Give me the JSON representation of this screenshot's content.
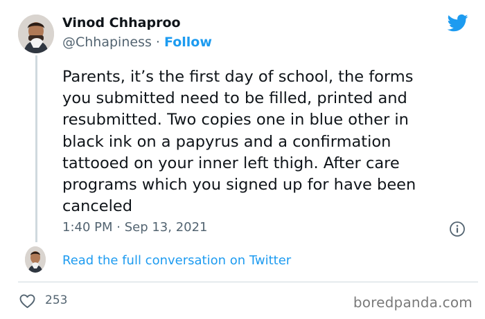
{
  "tweet": {
    "display_name": "Vinod Chhaproo",
    "handle": "@Chhapiness",
    "separator": " · ",
    "follow_label": "Follow",
    "text": "Parents, it’s the first day of school, the forms\nyou submitted need to be filled, printed and\nresubmitted. Two copies one in blue other in\nblack ink on a papyrus and a confirmation\ntattooed on your inner left thigh. After care\nprograms which you signed up for have been\ncanceled",
    "timestamp": "1:40 PM · Sep 13, 2021",
    "read_link": "Read the full conversation on Twitter",
    "like_count": "253"
  },
  "watermark": "boredpanda.com",
  "icons": {
    "brand": "twitter-bird-icon",
    "info": "info-icon",
    "like": "heart-icon"
  },
  "colors": {
    "link": "#1d9bf0",
    "text": "#0f1419",
    "secondary": "#536471",
    "divider": "#cfd9de"
  }
}
